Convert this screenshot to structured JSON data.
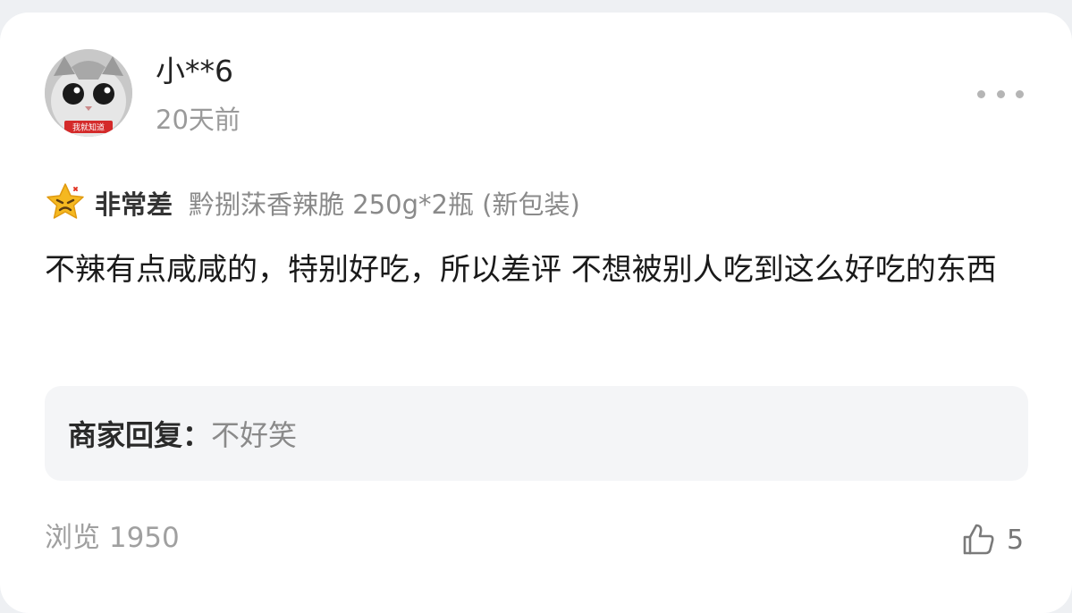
{
  "user": {
    "name": "小**6",
    "time": "20天前",
    "avatar_badge": "我就知道"
  },
  "rating": {
    "icon": "angry-star-icon",
    "label": "非常差",
    "product": "黔捌莯香辣脆 250g*2瓶 (新包装)"
  },
  "review": {
    "text": "不辣有点咸咸的，特别好吃，所以差评 不想被别人吃到这么好吃的东西"
  },
  "merchant_reply": {
    "label": "商家回复：",
    "text": "不好笑"
  },
  "footer": {
    "views": "浏览 1950",
    "likes": "5"
  },
  "colors": {
    "background": "#ffffff",
    "reply_background": "#f4f5f7",
    "muted_text": "#9a9a9a",
    "star": "#f5b820"
  }
}
